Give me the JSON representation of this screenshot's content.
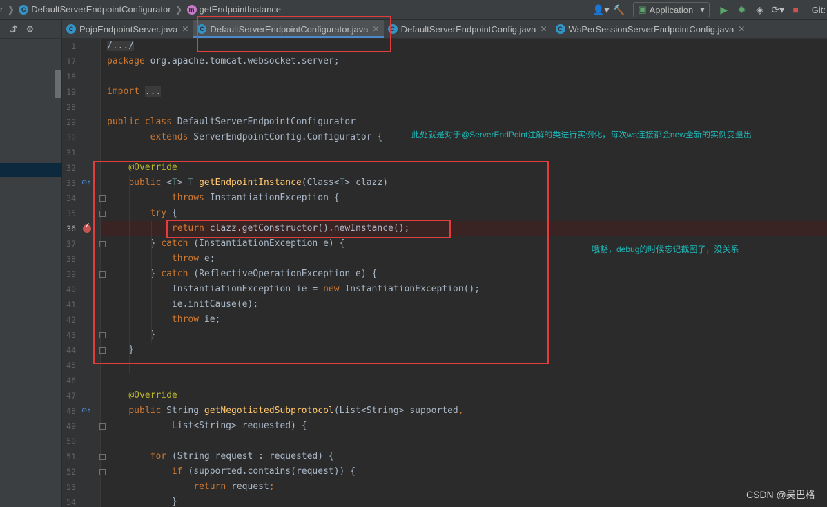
{
  "navbar": {
    "crumbs": [
      {
        "label": "r",
        "badge": ""
      },
      {
        "label": "DefaultServerEndpointConfigurator",
        "badge": "C"
      },
      {
        "label": "getEndpointInstance",
        "badge": "m"
      }
    ],
    "run_config": "Application",
    "git_label": "Git:"
  },
  "tabs": [
    {
      "label": "PojoEndpointServer.java",
      "active": false
    },
    {
      "label": "DefaultServerEndpointConfigurator.java",
      "active": true
    },
    {
      "label": "DefaultServerEndpointConfig.java",
      "active": false
    },
    {
      "label": "WsPerSessionServerEndpointConfig.java",
      "active": false
    }
  ],
  "lines": [
    {
      "n": "1",
      "html": "<span class=\"fold-txt\">/.../</span>"
    },
    {
      "n": "17",
      "html": "<span class=\"kw\">package</span> org.apache.tomcat.websocket.server;"
    },
    {
      "n": "18",
      "html": ""
    },
    {
      "n": "19",
      "html": "<span class=\"kw\">import</span> <span class=\"fold-txt\">...</span>"
    },
    {
      "n": "28",
      "html": ""
    },
    {
      "n": "29",
      "html": "<span class=\"kw\">public class</span> DefaultServerEndpointConfigurator"
    },
    {
      "n": "30",
      "html": "        <span class=\"kw\">extends</span> ServerEndpointConfig.Configurator {"
    },
    {
      "n": "31",
      "html": ""
    },
    {
      "n": "32",
      "html": "    <span class=\"ann\">@Override</span>"
    },
    {
      "n": "33",
      "html": "    <span class=\"kw\">public</span> &lt;<span class=\"tp\">T</span>&gt; <span class=\"tp\">T</span> <span class=\"fn\">getEndpointInstance</span>(Class&lt;<span class=\"tp\">T</span>&gt; clazz)"
    },
    {
      "n": "34",
      "html": "            <span class=\"kw\">throws</span> InstantiationException {"
    },
    {
      "n": "35",
      "html": "        <span class=\"kw\">try</span> {"
    },
    {
      "n": "36",
      "html": "            <span class=\"kw\">return</span> clazz.getConstructor().newInstance();"
    },
    {
      "n": "37",
      "html": "        } <span class=\"kw\">catch</span> (InstantiationException e) {"
    },
    {
      "n": "38",
      "html": "            <span class=\"kw\">throw</span> e;"
    },
    {
      "n": "39",
      "html": "        } <span class=\"kw\">catch</span> (ReflectiveOperationException e) {"
    },
    {
      "n": "40",
      "html": "            InstantiationException ie = <span class=\"kw\">new</span> InstantiationException();"
    },
    {
      "n": "41",
      "html": "            ie.initCause(e);"
    },
    {
      "n": "42",
      "html": "            <span class=\"kw\">throw</span> ie;"
    },
    {
      "n": "43",
      "html": "        }"
    },
    {
      "n": "44",
      "html": "    }"
    },
    {
      "n": "45",
      "html": ""
    },
    {
      "n": "46",
      "html": ""
    },
    {
      "n": "47",
      "html": "    <span class=\"ann\">@Override</span>"
    },
    {
      "n": "48",
      "html": "    <span class=\"kw\">public</span> String <span class=\"fn\">getNegotiatedSubprotocol</span>(List&lt;String&gt; supported<span class=\"kw\">,</span>"
    },
    {
      "n": "49",
      "html": "            List&lt;String&gt; requested) {"
    },
    {
      "n": "50",
      "html": ""
    },
    {
      "n": "51",
      "html": "        <span class=\"kw\">for</span> (String request : requested) {"
    },
    {
      "n": "52",
      "html": "            <span class=\"kw\">if</span> (supported.contains(request)) {"
    },
    {
      "n": "53",
      "html": "                <span class=\"kw\">return</span> request<span class=\"kw\">;</span>"
    },
    {
      "n": "54",
      "html": "            }"
    }
  ],
  "current_line": "36",
  "notes": {
    "note1": "此处就是对于@ServerEndPoint注解的类进行实例化，每次ws连接都会new全新的实例变量出",
    "note2": "哦豁，debug的时候忘记截图了，没关系"
  },
  "watermark": "CSDN @吴巴格",
  "colors": {
    "keyword": "#cc7832",
    "annotation": "#bbb529",
    "method": "#ffc66d",
    "box": "#e23d3d",
    "note": "#1fb7b7"
  }
}
